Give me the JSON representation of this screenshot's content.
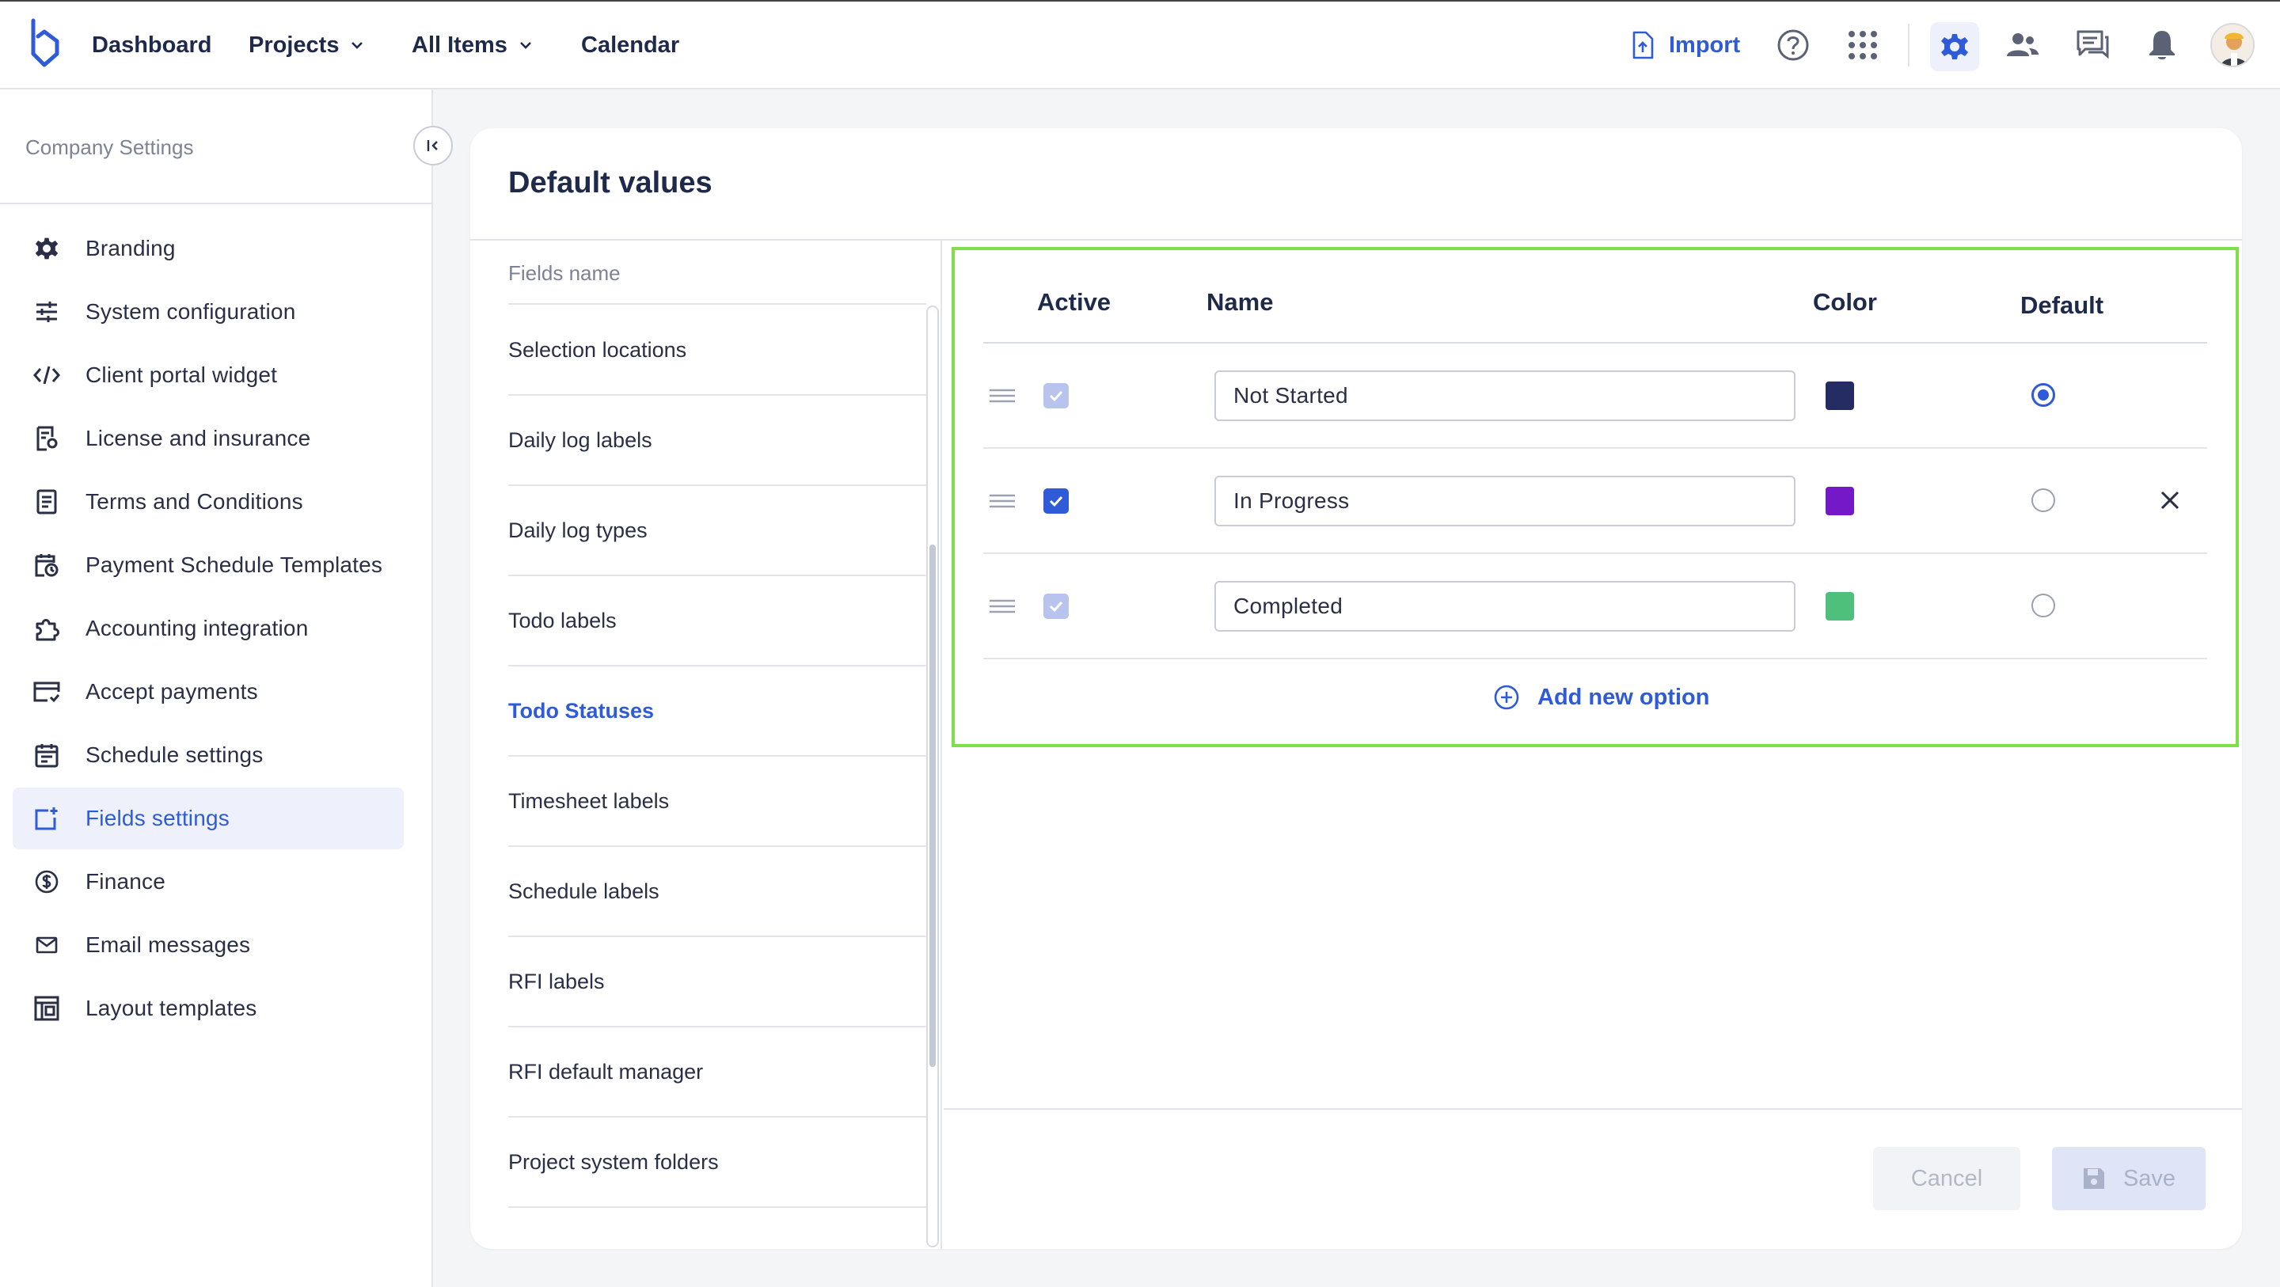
{
  "nav": {
    "dashboard": "Dashboard",
    "projects": "Projects",
    "all_items": "All Items",
    "calendar": "Calendar",
    "import": "Import"
  },
  "sidebar": {
    "title": "Company Settings",
    "items": [
      {
        "label": "Branding",
        "icon": "gear-icon"
      },
      {
        "label": "System configuration",
        "icon": "sliders-icon"
      },
      {
        "label": "Client portal widget",
        "icon": "code-icon"
      },
      {
        "label": "License and insurance",
        "icon": "license-icon"
      },
      {
        "label": "Terms and Conditions",
        "icon": "document-icon"
      },
      {
        "label": "Payment Schedule Templates",
        "icon": "calendar-clock-icon"
      },
      {
        "label": "Accounting integration",
        "icon": "puzzle-icon"
      },
      {
        "label": "Accept payments",
        "icon": "credit-card-icon"
      },
      {
        "label": "Schedule settings",
        "icon": "calendar-icon"
      },
      {
        "label": "Fields settings",
        "icon": "field-add-icon"
      },
      {
        "label": "Finance",
        "icon": "dollar-icon"
      },
      {
        "label": "Email messages",
        "icon": "mail-icon"
      },
      {
        "label": "Layout templates",
        "icon": "layout-icon"
      }
    ],
    "active_index": 9
  },
  "card": {
    "title": "Default values",
    "fields_header": "Fields name",
    "fields": [
      "Selection locations",
      "Daily log labels",
      "Daily log types",
      "Todo labels",
      "Todo Statuses",
      "Timesheet labels",
      "Schedule labels",
      "RFI labels",
      "RFI default manager",
      "Project system folders"
    ],
    "active_field_index": 4
  },
  "options": {
    "headers": {
      "active": "Active",
      "name": "Name",
      "color": "Color",
      "default": "Default"
    },
    "rows": [
      {
        "name": "Not Started",
        "active": true,
        "editable": false,
        "color": "#252c63",
        "default": true,
        "removable": false
      },
      {
        "name": "In Progress",
        "active": true,
        "editable": true,
        "color": "#7419c7",
        "default": false,
        "removable": true
      },
      {
        "name": "Completed",
        "active": true,
        "editable": false,
        "color": "#4fbf7d",
        "default": false,
        "removable": false
      }
    ],
    "add_label": "Add new option"
  },
  "footer": {
    "cancel": "Cancel",
    "save": "Save"
  },
  "colors": {
    "accent": "#2f5bd9",
    "highlight_border": "#7de04b"
  }
}
